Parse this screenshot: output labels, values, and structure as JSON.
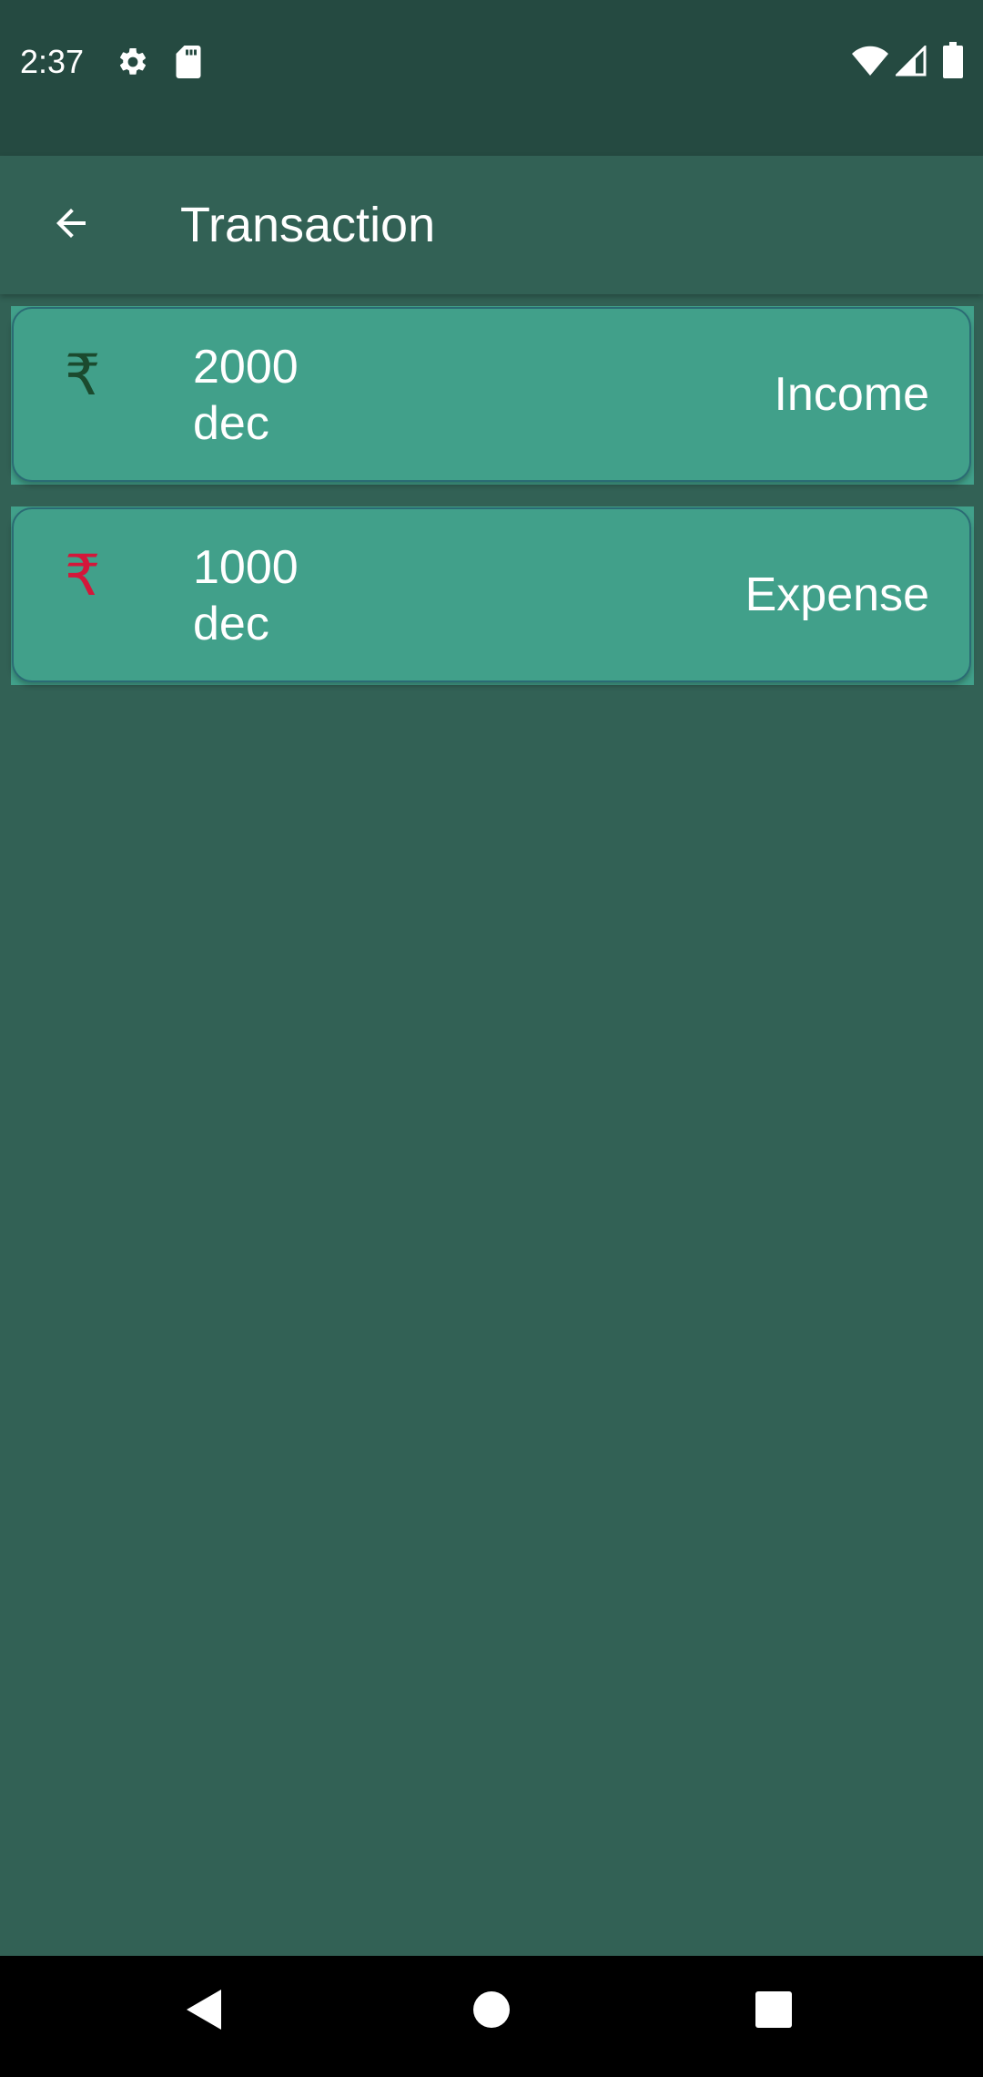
{
  "status_bar": {
    "time": "2:37",
    "icons": [
      "settings-icon",
      "sd-card-icon",
      "wifi-icon",
      "signal-icon",
      "battery-icon"
    ]
  },
  "app_bar": {
    "title": "Transaction",
    "back_icon": "arrow-back-icon"
  },
  "transactions": [
    {
      "symbol": "₹",
      "amount": "2000",
      "month": "dec",
      "type": "Income",
      "symbol_color": "#1b4a2e"
    },
    {
      "symbol": "₹",
      "amount": "1000",
      "month": "dec",
      "type": "Expense",
      "symbol_color": "#d4173a"
    }
  ],
  "nav_bar": {
    "icons": [
      "back-triangle-icon",
      "home-circle-icon",
      "recents-square-icon"
    ]
  },
  "colors": {
    "status_bar": "#254a41",
    "background": "#326155",
    "card": "#41a08a",
    "card_border": "#2b6b74"
  }
}
